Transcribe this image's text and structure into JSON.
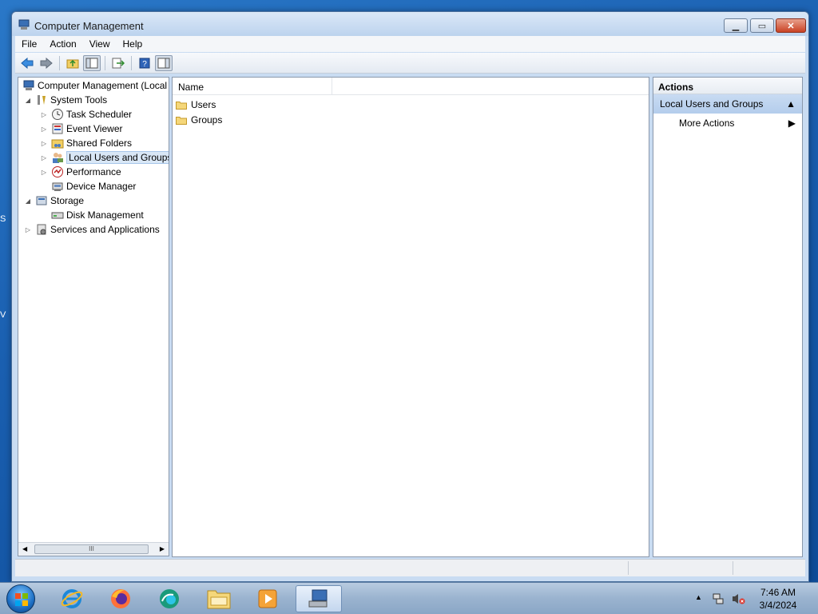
{
  "window": {
    "title": "Computer Management"
  },
  "menubar": {
    "items": [
      "File",
      "Action",
      "View",
      "Help"
    ]
  },
  "tree": {
    "items": [
      {
        "label": "Computer Management (Local",
        "level": 0,
        "arrow": "",
        "icon": "computer-management-icon"
      },
      {
        "label": "System Tools",
        "level": 1,
        "arrow": "◢",
        "icon": "system-tools-icon"
      },
      {
        "label": "Task Scheduler",
        "level": 2,
        "arrow": "▷",
        "icon": "clock-icon"
      },
      {
        "label": "Event Viewer",
        "level": 2,
        "arrow": "▷",
        "icon": "event-viewer-icon"
      },
      {
        "label": "Shared Folders",
        "level": 2,
        "arrow": "▷",
        "icon": "shared-folder-icon"
      },
      {
        "label": "Local Users and Groups",
        "level": 2,
        "arrow": "▷",
        "icon": "users-icon"
      },
      {
        "label": "Performance",
        "level": 2,
        "arrow": "▷",
        "icon": "performance-icon"
      },
      {
        "label": "Device Manager",
        "level": 2,
        "arrow": "",
        "icon": "device-manager-icon"
      },
      {
        "label": "Storage",
        "level": 1,
        "arrow": "◢",
        "icon": "storage-icon"
      },
      {
        "label": "Disk Management",
        "level": 2,
        "arrow": "",
        "icon": "disk-icon"
      },
      {
        "label": "Services and Applications",
        "level": 1,
        "arrow": "▷",
        "icon": "services-icon"
      }
    ],
    "scroll_label": "III"
  },
  "list": {
    "column_name": "Name",
    "rows": [
      {
        "name": "Users"
      },
      {
        "name": "Groups"
      }
    ]
  },
  "actions": {
    "header": "Actions",
    "section": "Local Users and Groups",
    "item": "More Actions"
  },
  "taskbar": {
    "time": "7:46 AM",
    "date": "3/4/2024",
    "apps": [
      "internet-explorer-icon",
      "firefox-icon",
      "edge-icon",
      "file-explorer-icon",
      "media-player-icon",
      "computer-management-icon"
    ]
  },
  "desktop_edge": {
    "left_char_1": "S",
    "left_char_2": "V"
  }
}
